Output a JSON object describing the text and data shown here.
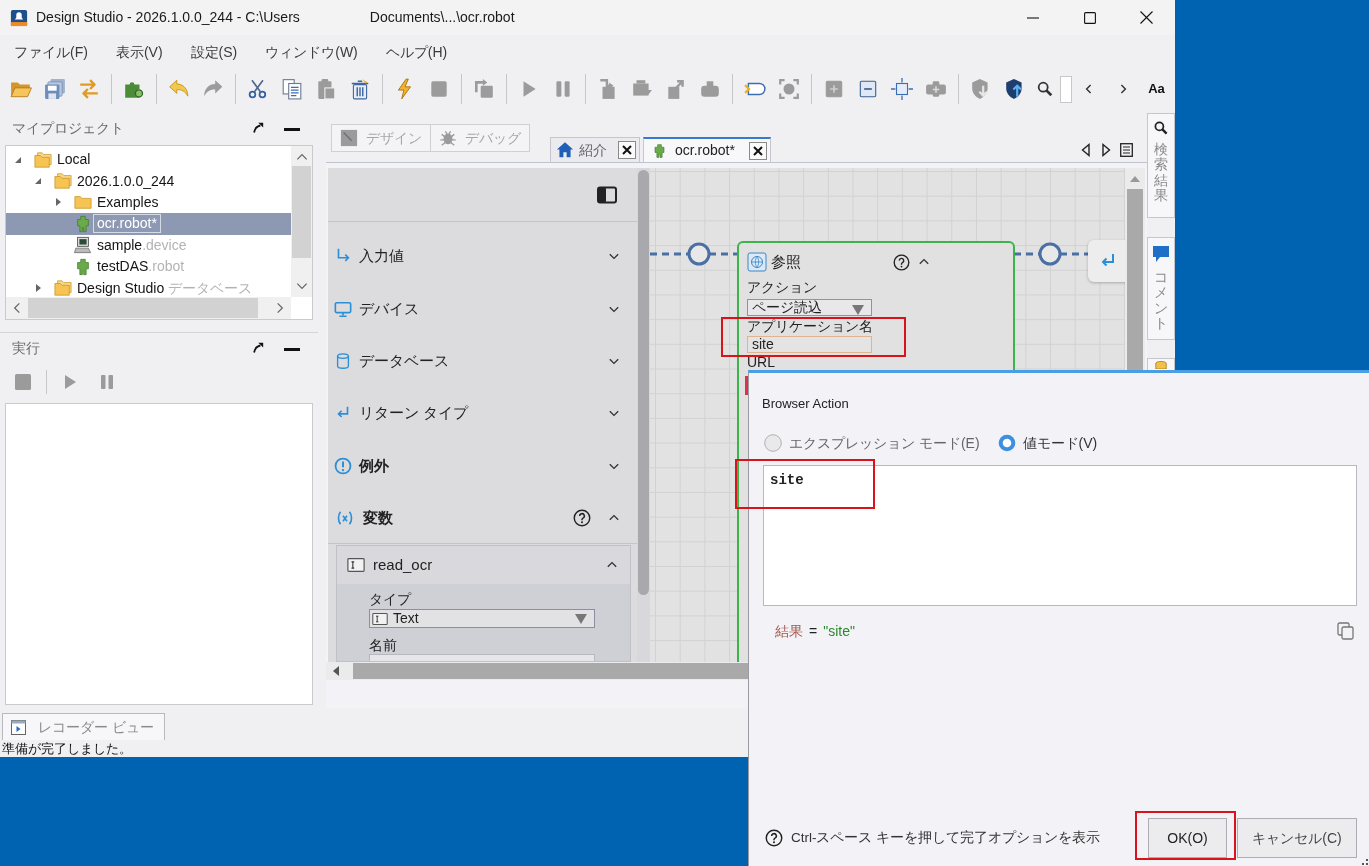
{
  "window": {
    "title": "Design Studio - 2026.1.0.0_244 - C:\\Users",
    "title_path": "Documents\\...\\ocr.robot"
  },
  "menu": [
    "ファイル(F)",
    "表示(V)",
    "設定(S)",
    "ウィンドウ(W)",
    "ヘルプ(H)"
  ],
  "toolbar": {
    "groups": [
      [
        {
          "disabled": false
        },
        {
          "disabled": false
        },
        {
          "disabled": false
        }
      ],
      [
        {
          "disabled": false
        }
      ],
      [
        {
          "disabled": false
        },
        {
          "disabled": true
        }
      ],
      [
        {
          "disabled": false
        },
        {
          "disabled": false
        },
        {
          "disabled": true
        },
        {
          "disabled": false
        }
      ],
      [
        {
          "disabled": false
        },
        {
          "disabled": true
        }
      ],
      [
        {
          "disabled": true
        }
      ],
      [
        {
          "disabled": true
        },
        {
          "disabled": true
        }
      ],
      [
        {
          "disabled": true
        },
        {
          "disabled": true
        },
        {
          "disabled": true
        },
        {
          "disabled": true
        }
      ],
      [
        {
          "disabled": false
        },
        {
          "disabled": true
        }
      ],
      [
        {
          "disabled": true
        },
        {
          "disabled": false
        },
        {
          "disabled": false
        },
        {
          "disabled": true
        }
      ],
      [
        {
          "disabled": true
        },
        {
          "disabled": false
        }
      ]
    ],
    "find": {
      "buttons": [
        {
          "disabled": false
        },
        {
          "disabled": false
        },
        {
          "disabled": false
        }
      ],
      "match_case": "Aa"
    }
  },
  "projects_panel": {
    "title": "マイプロジェクト",
    "tree": [
      {
        "label": "Local",
        "kind": "folder-stack",
        "expanded": true,
        "selected": false,
        "children": [
          {
            "label": "2026.1.0.0_244",
            "kind": "folder-stack",
            "expanded": true,
            "selected": false,
            "children": [
              {
                "label": "Examples",
                "kind": "folder",
                "expanded": false,
                "selected": false
              },
              {
                "label": "ocr.robot*",
                "kind": "robot",
                "selected": true
              },
              {
                "label": "sample",
                "suffix": ".device",
                "kind": "device",
                "selected": false
              },
              {
                "label": "testDAS",
                "suffix": ".robot",
                "kind": "robot",
                "selected": false
              }
            ]
          },
          {
            "label": "Design Studio",
            "suffix": " データベース",
            "kind": "folder-stack",
            "expanded": false,
            "selected": false
          }
        ]
      }
    ]
  },
  "run_panel": {
    "title": "実行",
    "controls": [
      {
        "disabled": true
      },
      {
        "disabled": true
      },
      {
        "disabled": true
      }
    ]
  },
  "bottom_tab": {
    "label": "レコーダー ビュー"
  },
  "status_bar": {
    "text": "準備が完了しました。"
  },
  "mode_buttons": [
    {
      "label": "デザイン",
      "disabled": true
    },
    {
      "label": "デバッグ",
      "disabled": true
    }
  ],
  "editor_tabs": [
    {
      "label": "紹介",
      "selected": false
    },
    {
      "label": "ocr.robot*",
      "selected": true
    }
  ],
  "properties": {
    "sections": [
      {
        "label": "入力値",
        "bold": false,
        "expanded": false,
        "help": false
      },
      {
        "label": "デバイス",
        "bold": false,
        "expanded": false,
        "help": false
      },
      {
        "label": "データベース",
        "bold": false,
        "expanded": false,
        "help": false
      },
      {
        "label": "リターン タイプ",
        "bold": false,
        "expanded": false,
        "help": false
      },
      {
        "label": "例外",
        "bold": true,
        "expanded": false,
        "help": false
      },
      {
        "label": "変数",
        "bold": true,
        "expanded": true,
        "help": true,
        "variables": [
          {
            "name": "read_ocr",
            "expanded": true,
            "type_label": "タイプ",
            "type_value": "Text",
            "name_label": "名前"
          }
        ]
      }
    ]
  },
  "canvas": {
    "step": {
      "title": "参照",
      "expanded": true,
      "fields": [
        {
          "kind": "select",
          "label": "アクション",
          "value": "ページ読込",
          "highlighted": false
        },
        {
          "kind": "input",
          "label": "アプリケーション名",
          "value": "site",
          "highlighted": true
        },
        {
          "kind": "label",
          "label": "URL",
          "highlighted": false
        }
      ]
    }
  },
  "side_tabs": [
    {
      "label": "検索結果"
    },
    {
      "label": "コメント"
    }
  ],
  "dialog": {
    "title": "Browser Action",
    "modes": [
      {
        "label": "エクスプレッション モード(E)",
        "selected": false
      },
      {
        "label": "値モード(V)",
        "selected": true
      }
    ],
    "editor": {
      "value": "site",
      "highlighted": true
    },
    "result": {
      "label": "結果",
      "operator": "=",
      "value": "\"site\""
    },
    "hint": "Ctrl-スペース キーを押して完了オプションを表示",
    "buttons": [
      {
        "label": "OK(O)",
        "highlighted": true
      },
      {
        "label": "キャンセル(C)",
        "highlighted": false
      }
    ]
  }
}
